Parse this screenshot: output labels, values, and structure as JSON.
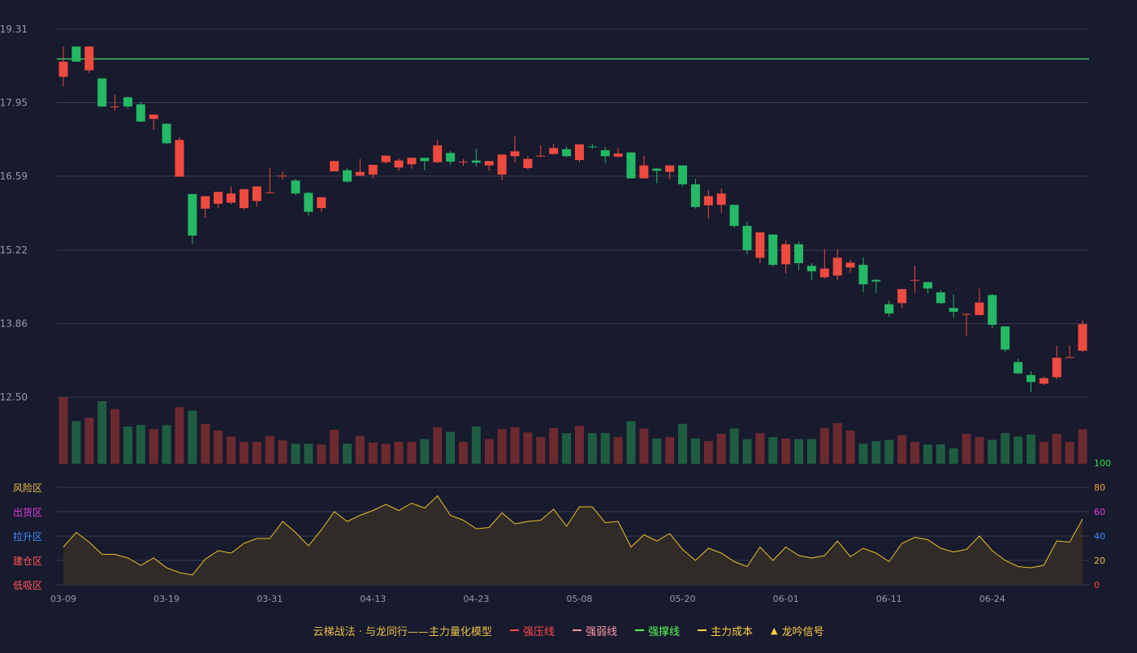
{
  "chart_data": {
    "type": "candlestick",
    "price_axis": {
      "ticks": [
        "19.31",
        "17.95",
        "16.59",
        "15.22",
        "13.86",
        "12.50"
      ],
      "min": 12.5,
      "max": 19.31
    },
    "reference_line": {
      "value": 18.76,
      "color": "#3ecf6a"
    },
    "osc_axis": {
      "ticks_right": [
        "100",
        "80",
        "60",
        "40",
        "20",
        "0"
      ],
      "tick_colors": [
        "#2ee04a",
        "#f0a030",
        "#e040e0",
        "#3a8fff",
        "#e8c04a",
        "#ff4040"
      ],
      "min": 0,
      "max": 100
    },
    "zones": [
      {
        "label": "风险区",
        "color": "#e8c04a"
      },
      {
        "label": "出货区",
        "color": "#e040e0"
      },
      {
        "label": "拉升区",
        "color": "#3a8fff"
      },
      {
        "label": "建仓区",
        "color": "#ff5a5a"
      },
      {
        "label": "低吸区",
        "color": "#ff5a5a"
      }
    ],
    "x_ticks": [
      {
        "i": 0,
        "label": "03-09"
      },
      {
        "i": 8,
        "label": "03-19"
      },
      {
        "i": 16,
        "label": "03-31"
      },
      {
        "i": 24,
        "label": "04-13"
      },
      {
        "i": 32,
        "label": "04-23"
      },
      {
        "i": 40,
        "label": "05-08"
      },
      {
        "i": 48,
        "label": "05-20"
      },
      {
        "i": 56,
        "label": "06-01"
      },
      {
        "i": 64,
        "label": "06-11"
      },
      {
        "i": 72,
        "label": "06-24"
      }
    ],
    "candles": [
      [
        18.43,
        18.71,
        18.99,
        18.25
      ],
      [
        18.99,
        18.71,
        18.99,
        18.71
      ],
      [
        18.55,
        18.99,
        18.99,
        18.5
      ],
      [
        18.4,
        17.88,
        18.4,
        17.87
      ],
      [
        17.88,
        17.88,
        18.1,
        17.8
      ],
      [
        18.05,
        17.88,
        18.06,
        17.84
      ],
      [
        17.92,
        17.6,
        17.97,
        17.6
      ],
      [
        17.65,
        17.73,
        17.73,
        17.45
      ],
      [
        17.56,
        17.2,
        17.57,
        17.18
      ],
      [
        16.58,
        17.26,
        17.31,
        16.58
      ],
      [
        16.26,
        15.49,
        16.26,
        15.33
      ],
      [
        15.99,
        16.22,
        16.22,
        15.82
      ],
      [
        16.08,
        16.3,
        16.3,
        16.0
      ],
      [
        16.1,
        16.27,
        16.4,
        16.07
      ],
      [
        16.0,
        16.35,
        16.35,
        15.97
      ],
      [
        16.13,
        16.4,
        16.4,
        16.03
      ],
      [
        16.29,
        16.29,
        16.75,
        16.29
      ],
      [
        16.6,
        16.6,
        16.68,
        16.53
      ],
      [
        16.51,
        16.27,
        16.54,
        16.24
      ],
      [
        16.28,
        15.93,
        16.3,
        15.86
      ],
      [
        16.0,
        16.2,
        16.2,
        15.93
      ],
      [
        16.68,
        16.87,
        16.87,
        16.68
      ],
      [
        16.7,
        16.49,
        16.74,
        16.47
      ],
      [
        16.6,
        16.67,
        16.91,
        16.6
      ],
      [
        16.62,
        16.8,
        16.8,
        16.55
      ],
      [
        16.85,
        16.97,
        16.97,
        16.82
      ],
      [
        16.75,
        16.88,
        16.92,
        16.69
      ],
      [
        16.81,
        16.93,
        16.93,
        16.73
      ],
      [
        16.93,
        16.87,
        16.92,
        16.7
      ],
      [
        16.85,
        17.16,
        17.26,
        16.83
      ],
      [
        17.02,
        16.86,
        17.06,
        16.8
      ],
      [
        16.86,
        16.86,
        16.91,
        16.78
      ],
      [
        16.88,
        16.84,
        17.1,
        16.77
      ],
      [
        16.79,
        16.87,
        16.87,
        16.69
      ],
      [
        16.62,
        16.99,
        16.99,
        16.51
      ],
      [
        16.96,
        17.05,
        17.33,
        16.84
      ],
      [
        16.74,
        16.91,
        16.96,
        16.71
      ],
      [
        16.97,
        16.97,
        17.16,
        16.95
      ],
      [
        17.0,
        17.11,
        17.19,
        16.99
      ],
      [
        17.09,
        16.96,
        17.14,
        16.94
      ],
      [
        16.89,
        17.18,
        17.18,
        16.85
      ],
      [
        17.14,
        17.13,
        17.19,
        17.1
      ],
      [
        17.07,
        16.96,
        17.13,
        16.83
      ],
      [
        16.95,
        17.01,
        17.11,
        16.93
      ],
      [
        17.03,
        16.55,
        17.03,
        16.55
      ],
      [
        16.55,
        16.79,
        16.97,
        16.55
      ],
      [
        16.73,
        16.69,
        16.74,
        16.46
      ],
      [
        16.67,
        16.79,
        16.79,
        16.53
      ],
      [
        16.79,
        16.44,
        16.79,
        16.4
      ],
      [
        16.44,
        16.02,
        16.54,
        15.99
      ],
      [
        16.05,
        16.22,
        16.33,
        15.8
      ],
      [
        16.06,
        16.27,
        16.36,
        15.91
      ],
      [
        16.06,
        15.67,
        16.06,
        15.63
      ],
      [
        15.67,
        15.22,
        15.75,
        15.14
      ],
      [
        15.08,
        15.55,
        15.55,
        14.98
      ],
      [
        15.51,
        14.95,
        15.51,
        14.92
      ],
      [
        14.96,
        15.33,
        15.4,
        14.79
      ],
      [
        15.33,
        14.98,
        15.38,
        14.85
      ],
      [
        14.93,
        14.83,
        14.98,
        14.66
      ],
      [
        14.72,
        14.88,
        15.24,
        14.69
      ],
      [
        14.75,
        15.08,
        15.24,
        14.66
      ],
      [
        14.9,
        14.99,
        15.05,
        14.8
      ],
      [
        14.95,
        14.59,
        15.09,
        14.44
      ],
      [
        14.67,
        14.64,
        14.69,
        14.43
      ],
      [
        14.22,
        14.05,
        14.29,
        13.99
      ],
      [
        14.24,
        14.5,
        14.5,
        14.15
      ],
      [
        14.67,
        14.67,
        14.93,
        14.43
      ],
      [
        14.63,
        14.51,
        14.63,
        14.42
      ],
      [
        14.44,
        14.24,
        14.48,
        14.22
      ],
      [
        14.15,
        14.08,
        14.4,
        13.97
      ],
      [
        14.04,
        14.04,
        14.05,
        13.64
      ],
      [
        14.02,
        14.25,
        14.51,
        14.02
      ],
      [
        14.39,
        13.84,
        14.41,
        13.78
      ],
      [
        13.81,
        13.38,
        13.81,
        13.33
      ],
      [
        13.15,
        12.94,
        13.21,
        12.93
      ],
      [
        12.91,
        12.78,
        12.98,
        12.59
      ],
      [
        12.75,
        12.85,
        12.88,
        12.72
      ],
      [
        12.87,
        13.23,
        13.45,
        12.83
      ],
      [
        13.24,
        13.24,
        13.46,
        13.24
      ],
      [
        13.36,
        13.85,
        13.93,
        13.34
      ]
    ],
    "volume": [
      100,
      64,
      69,
      94,
      82,
      56,
      58,
      52,
      58,
      85,
      80,
      60,
      50,
      41,
      33,
      33,
      42,
      35,
      30,
      30,
      29,
      51,
      30,
      42,
      32,
      30,
      33,
      33,
      37,
      55,
      48,
      33,
      56,
      37,
      52,
      55,
      47,
      40,
      54,
      46,
      57,
      46,
      46,
      40,
      64,
      53,
      38,
      40,
      60,
      38,
      34,
      45,
      53,
      37,
      46,
      40,
      38,
      37,
      37,
      54,
      61,
      50,
      30,
      34,
      36,
      43,
      33,
      29,
      29,
      23,
      45,
      40,
      36,
      46,
      41,
      44,
      33,
      45,
      33,
      52
    ],
    "oscillator": [
      31,
      43,
      35,
      25,
      25,
      22,
      16,
      22,
      14,
      10,
      8,
      21,
      28,
      26,
      34,
      38,
      38,
      52,
      43,
      32,
      45,
      60,
      52,
      57,
      61,
      66,
      61,
      67,
      63,
      73,
      57,
      53,
      46,
      47,
      59,
      50,
      52,
      53,
      62,
      48,
      64,
      64,
      51,
      52,
      31,
      41,
      36,
      42,
      29,
      20,
      30,
      26,
      19,
      15,
      31,
      20,
      31,
      24,
      22,
      24,
      36,
      23,
      30,
      26,
      19,
      34,
      39,
      37,
      30,
      27,
      29,
      40,
      28,
      20,
      15,
      14,
      16,
      36,
      35,
      54
    ],
    "legend": [
      {
        "label": "云梯战法 · 与龙同行——主力量化模型",
        "kind": "text",
        "color": "#e8c04a"
      },
      {
        "label": "强压线",
        "kind": "solid",
        "color": "#ff4a4a"
      },
      {
        "label": "强弱线",
        "kind": "dashed",
        "color": "#ff9aa8"
      },
      {
        "label": "强撑线",
        "kind": "solid",
        "color": "#5aff5a"
      },
      {
        "label": "主力成本",
        "kind": "dashed",
        "color": "#ffd040"
      },
      {
        "label": "龙吟信号",
        "kind": "triangle",
        "color": "#ffd040"
      }
    ],
    "colors": {
      "up": "#ef4a3f",
      "down": "#25b865",
      "vol_up": "#6b2a30",
      "vol_down": "#1f5d43",
      "osc_line": "#e8c02e",
      "osc_fill": "#332d26",
      "grid": "#3a3d54",
      "axis_text": "#9a9aae",
      "bg": "#181a2d"
    }
  }
}
